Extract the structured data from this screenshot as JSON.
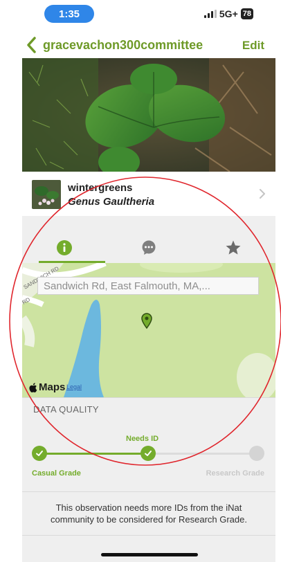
{
  "status_bar": {
    "time": "1:35",
    "network": "5G+",
    "battery": "78"
  },
  "nav": {
    "back_label": "gracevachon300committee",
    "edit_label": "Edit"
  },
  "taxon": {
    "common_name": "wintergreens",
    "scientific_name": "Genus Gaultheria"
  },
  "tabs": [
    {
      "icon": "info-icon",
      "active": true
    },
    {
      "icon": "chat-icon",
      "active": false
    },
    {
      "icon": "star-icon",
      "active": false
    }
  ],
  "map": {
    "location": "Sandwich Rd, East Falmouth, MA,...",
    "maps_label": "Maps",
    "legal_label": "Legal",
    "road_labels": [
      "SANDWICH RD",
      "RD"
    ]
  },
  "data_quality": {
    "header": "DATA QUALITY",
    "current_grade": "Needs ID",
    "casual_label": "Casual Grade",
    "research_label": "Research Grade",
    "progress": 0.5,
    "message": "This observation needs more IDs from the iNat community to be considered for Research Grade."
  },
  "colors": {
    "accent": "#74ac2c",
    "nav_text": "#6e9a28",
    "time_pill": "#2f86e8",
    "annotation": "#e0262d"
  }
}
